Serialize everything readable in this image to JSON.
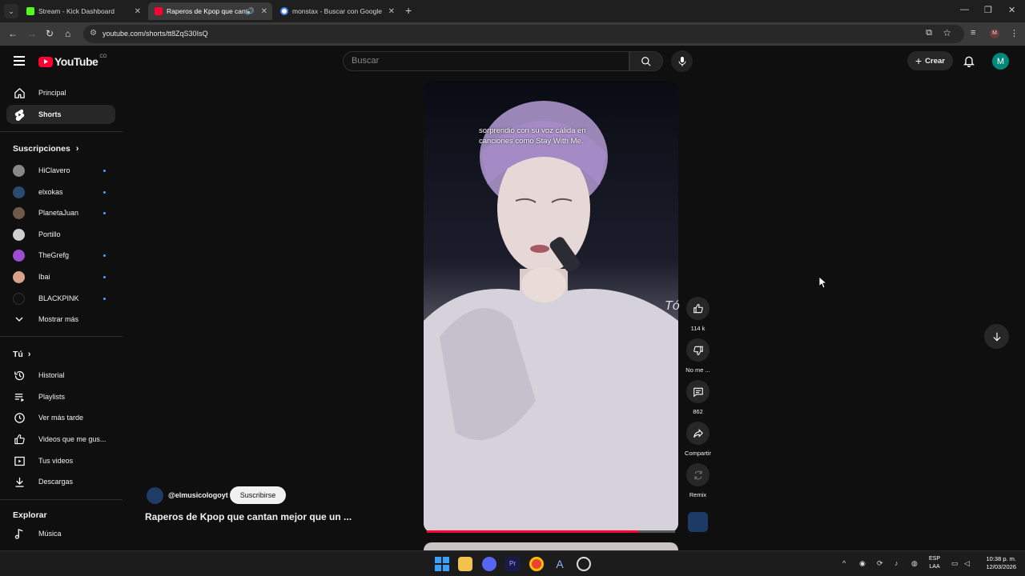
{
  "browser": {
    "tabs": [
      {
        "title": "Stream - Kick Dashboard",
        "favicon_color": "#53fc18"
      },
      {
        "title": "Raperos de Kpop que canta",
        "favicon_color": "#ff0033"
      },
      {
        "title": "monstax - Buscar con Google",
        "favicon_color": "#4285f4"
      }
    ],
    "url": "youtube.com/shorts/tt8ZqS30IsQ"
  },
  "header": {
    "logo_text": "YouTube",
    "country_code": "CO",
    "search_placeholder": "Buscar",
    "create_label": "Crear",
    "avatar_letter": "M"
  },
  "sidebar": {
    "main": [
      {
        "label": "Principal",
        "icon": "home-icon"
      },
      {
        "label": "Shorts",
        "icon": "shorts-icon"
      }
    ],
    "subscriptions_title": "Suscripciones",
    "subscriptions": [
      {
        "label": "HiClavero",
        "color": "#888888",
        "live": true
      },
      {
        "label": "elxokas",
        "color": "#2b4a6f",
        "live": true
      },
      {
        "label": "PlanetaJuan",
        "color": "#6d5a4a",
        "live": true
      },
      {
        "label": "Portillo",
        "color": "#cfcfcf",
        "live": false
      },
      {
        "label": "TheGrefg",
        "color": "#9b4fd0",
        "live": true
      },
      {
        "label": "Ibai",
        "color": "#d9a38a",
        "live": true
      },
      {
        "label": "BLACKPINK",
        "color": "#111111",
        "live": true
      }
    ],
    "show_more": "Mostrar más",
    "you_title": "Tú",
    "you": [
      {
        "label": "Historial",
        "icon": "history-icon"
      },
      {
        "label": "Playlists",
        "icon": "playlist-icon"
      },
      {
        "label": "Ver más tarde",
        "icon": "clock-icon"
      },
      {
        "label": "Videos que me gus...",
        "icon": "like-icon"
      },
      {
        "label": "Tus videos",
        "icon": "video-icon"
      },
      {
        "label": "Descargas",
        "icon": "download-icon"
      }
    ],
    "explore_title": "Explorar",
    "explore": [
      {
        "label": "Música",
        "icon": "music-icon"
      }
    ]
  },
  "short": {
    "caption_line1": "sorprendió con su voz cálida en",
    "caption_line2": "canciones como Stay With Me.",
    "side_text": "Tó",
    "progress": 0.85,
    "channel": "@elmusicologoyt",
    "subscribe_label": "Suscribirse",
    "title": "Raperos de Kpop que cantan mejor que un ..."
  },
  "actions": {
    "likes": "114 k",
    "dislike": "No me ...",
    "comments": "862",
    "share": "Compartir",
    "remix": "Remix"
  },
  "taskbar": {
    "lang_line1": "ESP",
    "lang_line2": "LAA",
    "time": "10:38 p. m.",
    "date": "12/03/2026"
  }
}
